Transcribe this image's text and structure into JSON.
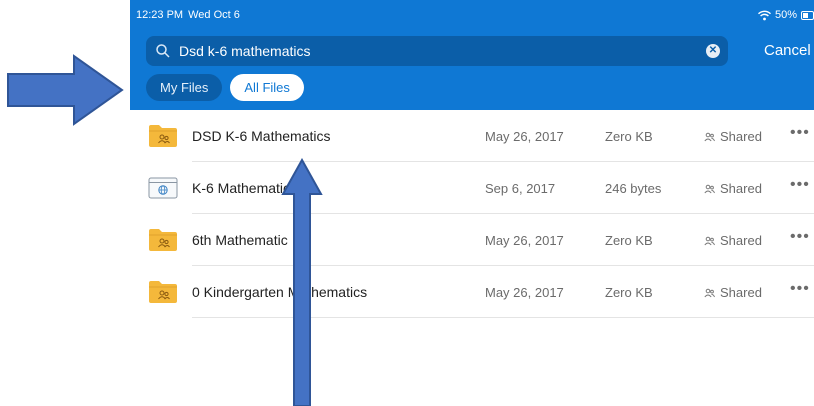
{
  "status_bar": {
    "time": "12:23 PM",
    "date": "Wed Oct 6",
    "battery": "50%"
  },
  "search": {
    "query": "Dsd k-6 mathematics",
    "cancel_label": "Cancel"
  },
  "tabs": [
    {
      "label": "My Files",
      "active": false
    },
    {
      "label": "All Files",
      "active": true
    }
  ],
  "files": [
    {
      "name": "DSD K-6 Mathematics",
      "date": "May 26, 2017",
      "size": "Zero KB",
      "sharing": "Shared",
      "icon": "shared-folder-icon"
    },
    {
      "name": "K-6 Mathematic",
      "date": "Sep 6, 2017",
      "size": "246 bytes",
      "sharing": "Shared",
      "icon": "web-file-icon"
    },
    {
      "name": "6th Mathematic",
      "date": "May 26, 2017",
      "size": "Zero KB",
      "sharing": "Shared",
      "icon": "shared-folder-icon"
    },
    {
      "name": "0 Kindergarten Mathematics",
      "date": "May 26, 2017",
      "size": "Zero KB",
      "sharing": "Shared",
      "icon": "shared-folder-icon"
    }
  ],
  "more_glyph": "•••",
  "colors": {
    "accent": "#0f78d4",
    "accent_dark": "#0b5ea8",
    "folder": "#f4b83b",
    "arrow": "#4472c4"
  }
}
